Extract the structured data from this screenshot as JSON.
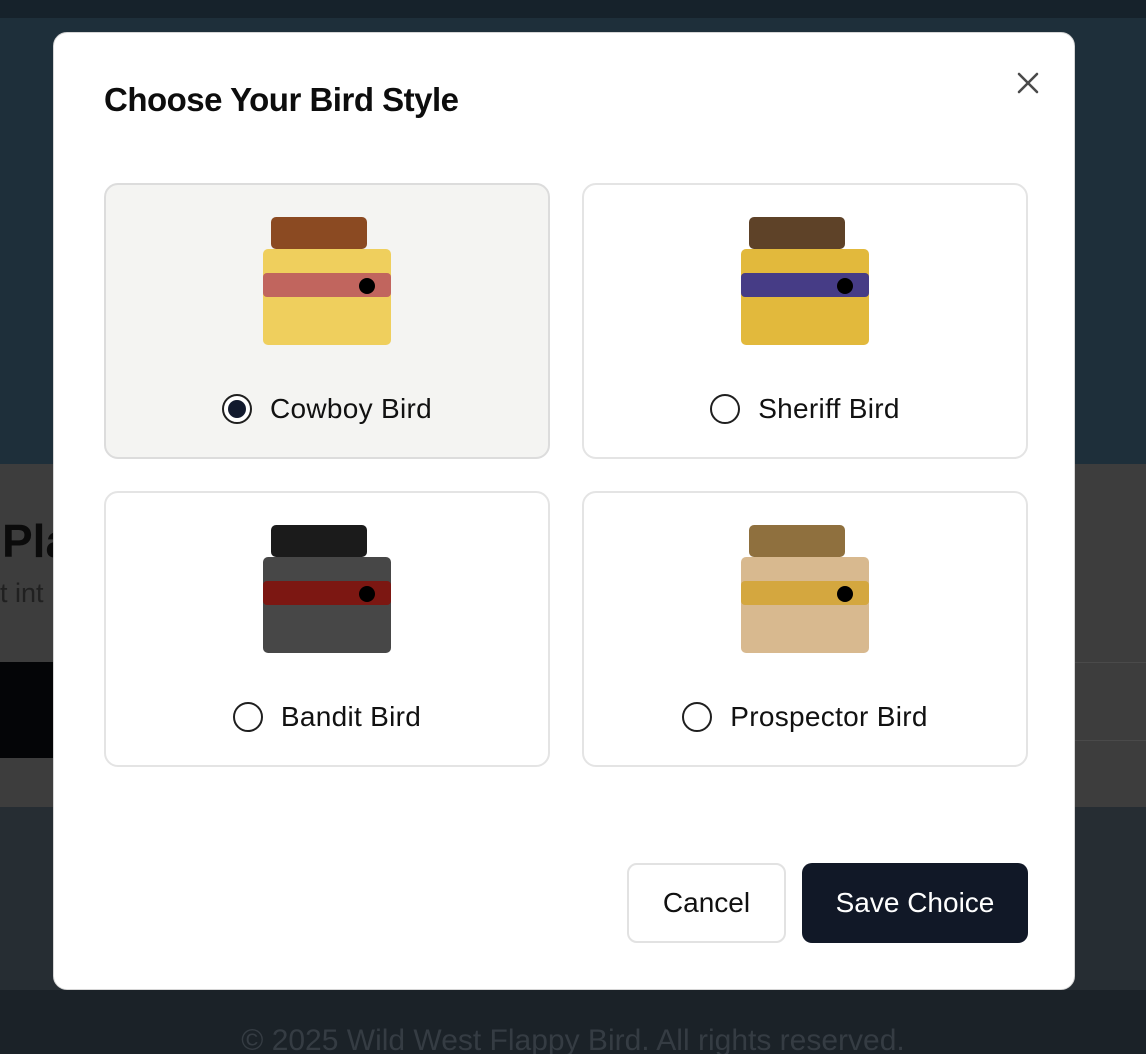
{
  "background": {
    "heading_partial": "Pla",
    "subtext_partial": "t int",
    "footer": "© 2025 Wild West Flappy Bird. All rights reserved."
  },
  "modal": {
    "title": "Choose Your Bird Style",
    "close_icon": "close-icon",
    "selected_option": "Cowboy Bird",
    "options": [
      {
        "label": "Cowboy Bird",
        "selected": true,
        "colors": {
          "hat": "#8b4a22",
          "body": "#efcf5d",
          "band": "#c1655e",
          "eye": "#000000"
        }
      },
      {
        "label": "Sheriff Bird",
        "selected": false,
        "colors": {
          "hat": "#5e4228",
          "body": "#e2b93c",
          "band": "#463c86",
          "eye": "#000000"
        }
      },
      {
        "label": "Bandit Bird",
        "selected": false,
        "colors": {
          "hat": "#1b1b1b",
          "body": "#474747",
          "band": "#7c1712",
          "eye": "#000000"
        }
      },
      {
        "label": "Prospector Bird",
        "selected": false,
        "colors": {
          "hat": "#8f703e",
          "body": "#d8b98f",
          "band": "#d4a73f",
          "eye": "#000000"
        }
      }
    ],
    "buttons": {
      "cancel_label": "Cancel",
      "save_label": "Save Choice"
    },
    "colors": {
      "primary_button": "#111827",
      "selected_card": "#f4f4f2"
    }
  }
}
